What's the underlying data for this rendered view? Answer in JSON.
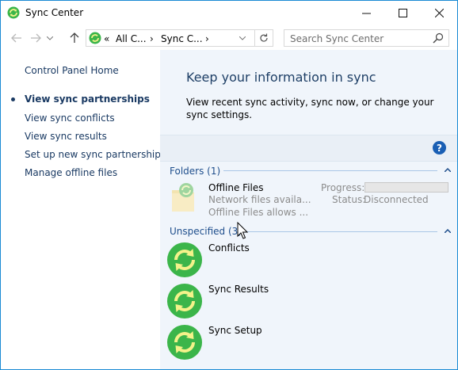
{
  "window": {
    "title": "Sync Center"
  },
  "toolbar": {
    "address_segments": [
      "«",
      "All C...",
      "›",
      "Sync C...",
      "›"
    ],
    "search_placeholder": "Search Sync Center"
  },
  "sidebar": {
    "items": [
      {
        "label": "Control Panel Home",
        "active": false
      },
      {
        "label": "View sync partnerships",
        "active": true
      },
      {
        "label": "View sync conflicts",
        "active": false
      },
      {
        "label": "View sync results",
        "active": false
      },
      {
        "label": "Set up new sync partnerships",
        "active": false
      },
      {
        "label": "Manage offline files",
        "active": false
      }
    ]
  },
  "main": {
    "heading": "Keep your information in sync",
    "description": "View recent sync activity, sync now, or change your sync settings.",
    "help": "?",
    "groups": [
      {
        "label": "Folders (1)",
        "items": [
          {
            "title": "Offline Files",
            "lines": [
              "Network files availa...",
              "Offline Files allows ..."
            ],
            "progress_label": "Progress:",
            "status_label": "Status:",
            "status_value": "Disconnected"
          }
        ]
      },
      {
        "label": "Unspecified (3)",
        "items": [
          {
            "title": "Conflicts"
          },
          {
            "title": "Sync Results"
          },
          {
            "title": "Sync Setup"
          }
        ]
      }
    ]
  },
  "colors": {
    "accent": "#1a8ad4",
    "link": "#1a3a63",
    "heading": "#1e3f66",
    "sync_green": "#3bb54a"
  }
}
